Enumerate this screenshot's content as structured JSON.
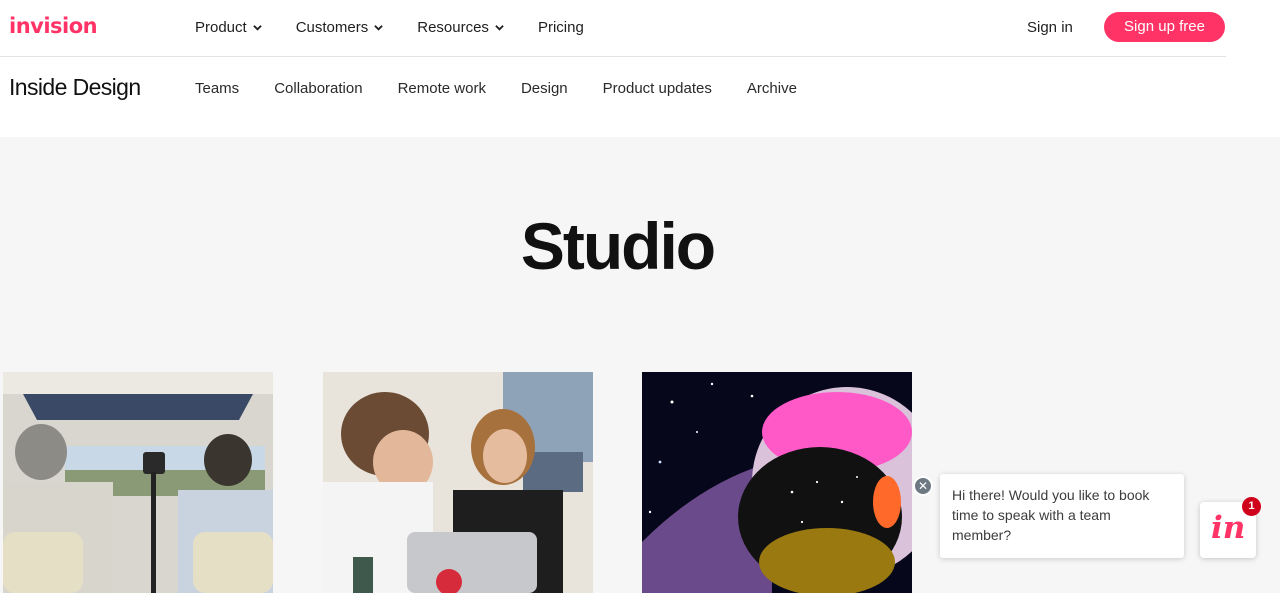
{
  "header": {
    "logo_text": "invision",
    "nav": [
      {
        "label": "Product",
        "has_dropdown": true
      },
      {
        "label": "Customers",
        "has_dropdown": true
      },
      {
        "label": "Resources",
        "has_dropdown": true
      },
      {
        "label": "Pricing",
        "has_dropdown": false
      }
    ],
    "signin_label": "Sign in",
    "signup_label": "Sign up free"
  },
  "subheader": {
    "brand": "Inside Design",
    "items": [
      "Teams",
      "Collaboration",
      "Remote work",
      "Design",
      "Product updates",
      "Archive"
    ]
  },
  "main": {
    "title": "Studio"
  },
  "chat": {
    "message": "Hi there! Would you like to book time to speak with a team member?",
    "close_icon": "close-icon",
    "launcher_text": "in",
    "badge_count": "1"
  },
  "colors": {
    "brand_pink": "#ff3366",
    "background": "#f6f6f6",
    "badge_red": "#d0021b"
  }
}
